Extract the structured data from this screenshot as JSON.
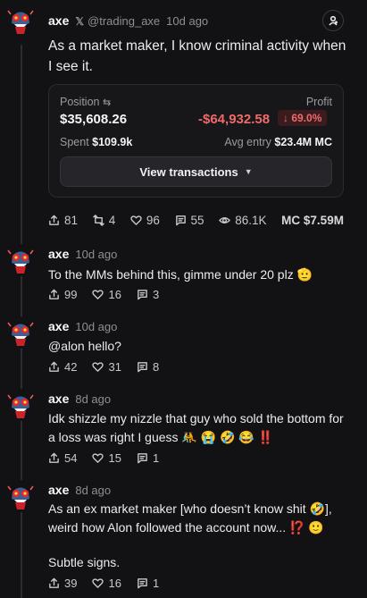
{
  "main_post": {
    "author": "axe",
    "handle": "@trading_axe",
    "time": "10d ago",
    "text": "As a market maker, I know criminal activity when I see it.",
    "position": {
      "position_label": "Position",
      "profit_label": "Profit",
      "position_value": "$35,608.26",
      "profit_value": "-$64,932.58",
      "profit_pct": "↓ 69.0%",
      "spent_label": "Spent",
      "spent_value": "$109.9k",
      "avg_entry_label": "Avg entry",
      "avg_entry_value": "$23.4M MC",
      "view_button": "View transactions"
    },
    "stats": {
      "shares": "81",
      "reposts": "4",
      "likes": "96",
      "comments": "55",
      "views": "86.1K",
      "mc": "MC $7.59M"
    }
  },
  "replies": [
    {
      "author": "axe",
      "time": "10d ago",
      "text": "To the MMs behind this, gimme under 20 plz 🫡",
      "shares": "99",
      "likes": "16",
      "comments": "3"
    },
    {
      "author": "axe",
      "time": "10d ago",
      "text": "@alon hello?",
      "shares": "42",
      "likes": "31",
      "comments": "8"
    },
    {
      "author": "axe",
      "time": "8d ago",
      "text": "Idk shizzle my nizzle that guy who sold the bottom for a loss was right I guess 🤼 😭 🤣 😂 ‼️",
      "shares": "54",
      "likes": "15",
      "comments": "1"
    },
    {
      "author": "axe",
      "time": "8d ago",
      "text_line1": "As an ex market maker [who doesn’t know shit 🤣], weird how Alon followed the account now... ⁉️ 🙂",
      "text_line2": "Subtle signs.",
      "shares": "39",
      "likes": "16",
      "comments": "1"
    }
  ],
  "colors": {
    "background": "#121214",
    "negative": "#f06a6a",
    "muted": "#8e8e96"
  }
}
